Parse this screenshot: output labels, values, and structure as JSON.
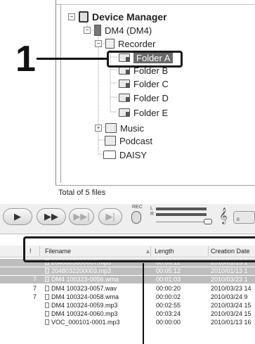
{
  "callout_number": "1",
  "tree": {
    "root": "Device Manager",
    "device": "DM4 (DM4)",
    "recorder": "Recorder",
    "folders": [
      "Folder  A",
      "Folder B",
      "Folder C",
      "Folder D",
      "Folder E"
    ],
    "music": "Music",
    "podcast": "Podcast",
    "daisy": "DAISY",
    "expand_minus": "−",
    "expand_plus": "+"
  },
  "status": {
    "text": "Total of 5 files"
  },
  "toolbar": {
    "play": "▶",
    "fast_forward": "▶▶",
    "next": "▶▶|",
    "skip": "▶|",
    "rec_label": "REC",
    "l_label": "L",
    "r_label": "R",
    "clef": "𝄞",
    "small_btn_label": "B"
  },
  "list": {
    "headers": {
      "flag": "!",
      "filename": "Filename",
      "sort": "▲",
      "length": "Length",
      "created": "Creation Date"
    },
    "rows": [
      {
        "flag": "",
        "name": "2048005600007.mp3",
        "length": "00:06:11",
        "date": "2010/01/13 1",
        "selected": true
      },
      {
        "flag": "",
        "name": "2048032200003.mp3",
        "length": "00:05:12",
        "date": "2010/01/13 1",
        "selected": true
      },
      {
        "flag": "7",
        "name": "DM4 100323-0056.wma",
        "length": "00:01:03",
        "date": "2010/03/23 1",
        "selected": true
      },
      {
        "flag": "7",
        "name": "DM4 100323-0057.wav",
        "length": "00:00:20",
        "date": "2010/03/23 14",
        "selected": false
      },
      {
        "flag": "7",
        "name": "DM4 100324-0058.wma",
        "length": "00:00:02",
        "date": "2010/03/24 9",
        "selected": false
      },
      {
        "flag": "",
        "name": "DM4 100324-0059.mp3",
        "length": "00:02:55",
        "date": "2010/03/24 15",
        "selected": false
      },
      {
        "flag": "",
        "name": "DM4 100324-0060.mp3",
        "length": "00:03:24",
        "date": "2010/03/24 15",
        "selected": false
      },
      {
        "flag": "",
        "name": "VOC_000101-0001.mp3",
        "length": "00:00:00",
        "date": "2010/01/13 16",
        "selected": false
      }
    ]
  }
}
